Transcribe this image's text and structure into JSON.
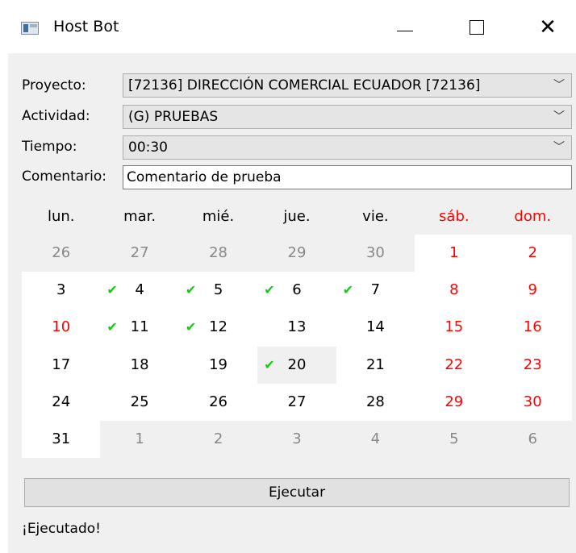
{
  "window": {
    "title": "Host Bot",
    "min_icon": "minimize-icon",
    "max_icon": "maximize-icon",
    "close_icon": "close-icon"
  },
  "form": {
    "proyecto_label": "Proyecto:",
    "proyecto_value": "[72136] DIRECCIÓN COMERCIAL ECUADOR [72136]",
    "actividad_label": "Actividad:",
    "actividad_value": "(G) PRUEBAS",
    "tiempo_label": "Tiempo:",
    "tiempo_value": "00:30",
    "comentario_label": "Comentario:",
    "comentario_value": "Comentario de prueba"
  },
  "calendar": {
    "headers": [
      "lun.",
      "mar.",
      "mié.",
      "jue.",
      "vie.",
      "sáb.",
      "dom."
    ],
    "weeks": [
      [
        {
          "d": "26",
          "o": true
        },
        {
          "d": "27",
          "o": true
        },
        {
          "d": "28",
          "o": true
        },
        {
          "d": "29",
          "o": true
        },
        {
          "d": "30",
          "o": true
        },
        {
          "d": "1"
        },
        {
          "d": "2"
        }
      ],
      [
        {
          "d": "3"
        },
        {
          "d": "4",
          "c": true
        },
        {
          "d": "5",
          "c": true
        },
        {
          "d": "6",
          "c": true
        },
        {
          "d": "7",
          "c": true
        },
        {
          "d": "8"
        },
        {
          "d": "9"
        }
      ],
      [
        {
          "d": "10",
          "h": true
        },
        {
          "d": "11",
          "c": true
        },
        {
          "d": "12",
          "c": true
        },
        {
          "d": "13"
        },
        {
          "d": "14"
        },
        {
          "d": "15"
        },
        {
          "d": "16"
        }
      ],
      [
        {
          "d": "17"
        },
        {
          "d": "18"
        },
        {
          "d": "19"
        },
        {
          "d": "20",
          "c": true,
          "s": true
        },
        {
          "d": "21"
        },
        {
          "d": "22"
        },
        {
          "d": "23"
        }
      ],
      [
        {
          "d": "24"
        },
        {
          "d": "25"
        },
        {
          "d": "26"
        },
        {
          "d": "27"
        },
        {
          "d": "28"
        },
        {
          "d": "29"
        },
        {
          "d": "30"
        }
      ],
      [
        {
          "d": "31"
        },
        {
          "d": "1",
          "o": true
        },
        {
          "d": "2",
          "o": true
        },
        {
          "d": "3",
          "o": true
        },
        {
          "d": "4",
          "o": true
        },
        {
          "d": "5",
          "o": true
        },
        {
          "d": "6",
          "o": true
        }
      ]
    ],
    "check_glyph": "✔",
    "check_color": "#18c818",
    "weekend_color": "#ff0000"
  },
  "execute_button": "Ejecutar",
  "status": "¡Ejecutado!"
}
